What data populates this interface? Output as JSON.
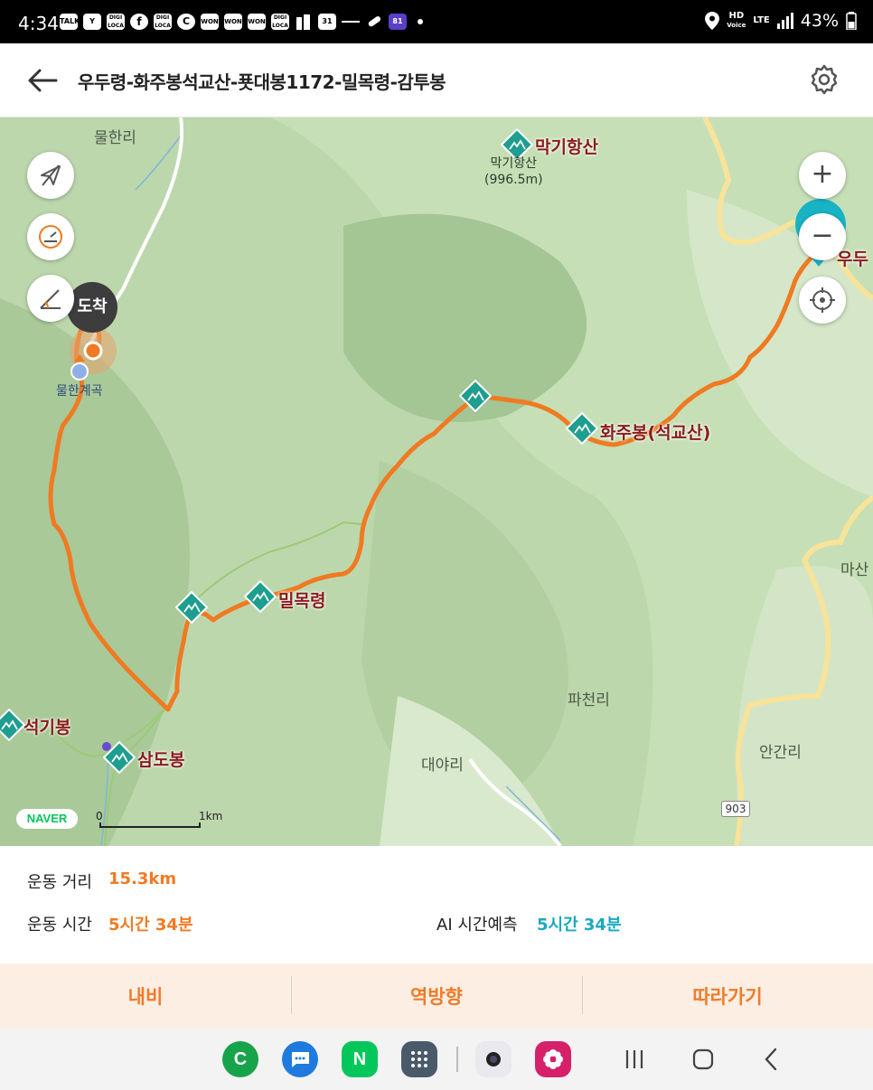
{
  "status_bar": {
    "time": "4:34",
    "left_icons": [
      "TALK",
      "Y",
      "DIGI LOCA",
      "f",
      "DIGI LOCA",
      "C",
      "WON",
      "WON",
      "WON",
      "DIGI LOCA",
      "building",
      "31",
      "bar",
      "pill",
      "81"
    ],
    "hd_voice": "HD",
    "voice_label": "Voice",
    "network": "LTE",
    "battery": "43%"
  },
  "header": {
    "title": "우두령-화주봉석교산-푯대봉1172-밀목령-감투봉"
  },
  "map": {
    "places": {
      "mulhanri": "물한리",
      "mulhan_valley": "물한계곡",
      "pacheonri": "파천리",
      "daeyari": "대야리",
      "anganri": "안간리",
      "masan": "마산"
    },
    "peaks": {
      "makgihangsan": "막기항산",
      "makgihangsan_sub": "막기항산",
      "makgihangsan_alt": "(996.5m)",
      "hwajubong": "화주봉(석교산)",
      "milmokryeong": "밀목령",
      "seokgibong": "석기봉",
      "samdobong": "삼도봉",
      "udu_partial": "우두"
    },
    "arrival_badge": "도착",
    "zoom_in": "+",
    "zoom_out": "−",
    "naver_logo": "NAVER",
    "scale_zero": "0",
    "scale_unit": "1km",
    "road_number": "903",
    "route_color": "#f07a22"
  },
  "summary": {
    "distance_label": "운동 거리",
    "distance_value": "15.3km",
    "time_label": "운동 시간",
    "time_value": "5시간 34분",
    "ai_label": "AI 시간예측",
    "ai_value": "5시간 34분"
  },
  "actions": {
    "navi": "내비",
    "reverse": "역방향",
    "follow": "따라가기"
  },
  "navbar": {
    "apps": [
      "C",
      "chat",
      "N",
      "apps",
      "camera",
      "flower"
    ]
  }
}
